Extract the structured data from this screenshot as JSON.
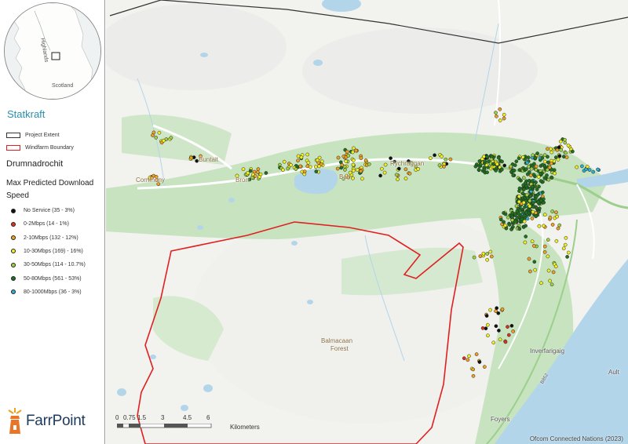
{
  "inset": {
    "labels": [
      "Highlands",
      "Scotland"
    ]
  },
  "brand": "Statkraft",
  "legend_boundaries": [
    {
      "label": "Project Extent",
      "stroke": "#333333"
    },
    {
      "label": "Windfarm Boundary",
      "stroke": "#e02020"
    }
  ],
  "site_name": "Drumnadrochit",
  "legend_title": "Max Predicted Download Speed",
  "speed_classes": [
    {
      "label": "No Service (35 - 3%)",
      "color": "#111111"
    },
    {
      "label": "0-2Mbps (14 - 1%)",
      "color": "#e03020"
    },
    {
      "label": "2-10Mbps (132 - 12%)",
      "color": "#f0a020"
    },
    {
      "label": "10-30Mbps (169) - 16%)",
      "color": "#f0f020"
    },
    {
      "label": "30-50Mbps (114 - 10.7%)",
      "color": "#a0d040"
    },
    {
      "label": "50-80Mbps (561 - 53%)",
      "color": "#207020"
    },
    {
      "label": "80-1000Mbps (36 - 3%)",
      "color": "#30b0d0"
    }
  ],
  "logo": "FarrPoint",
  "places": [
    {
      "name": "Corrimony"
    },
    {
      "name": "Buntait"
    },
    {
      "name": "Bron"
    },
    {
      "name": "Bal"
    },
    {
      "name": "Rychraggan"
    },
    {
      "name": "Balmacaan"
    },
    {
      "name": "Forest"
    },
    {
      "name": "Inverfarigaig"
    },
    {
      "name": "Foyers"
    },
    {
      "name": "Ault"
    },
    {
      "name": "B852"
    }
  ],
  "scalebar": {
    "ticks": [
      "0",
      "0.75",
      "1.5",
      "3",
      "4.5",
      "6"
    ],
    "unit": "Kilometers"
  },
  "attribution": "Ofcom Connected Nations (2023)",
  "colors": {
    "water": "#b3d5ea",
    "woodland": "#c7e3c0",
    "terrain": "#f2f2ef",
    "road": "#ffffff",
    "road_major": "#9ccf8c",
    "windfarm": "#e02020",
    "extent": "#333333"
  }
}
